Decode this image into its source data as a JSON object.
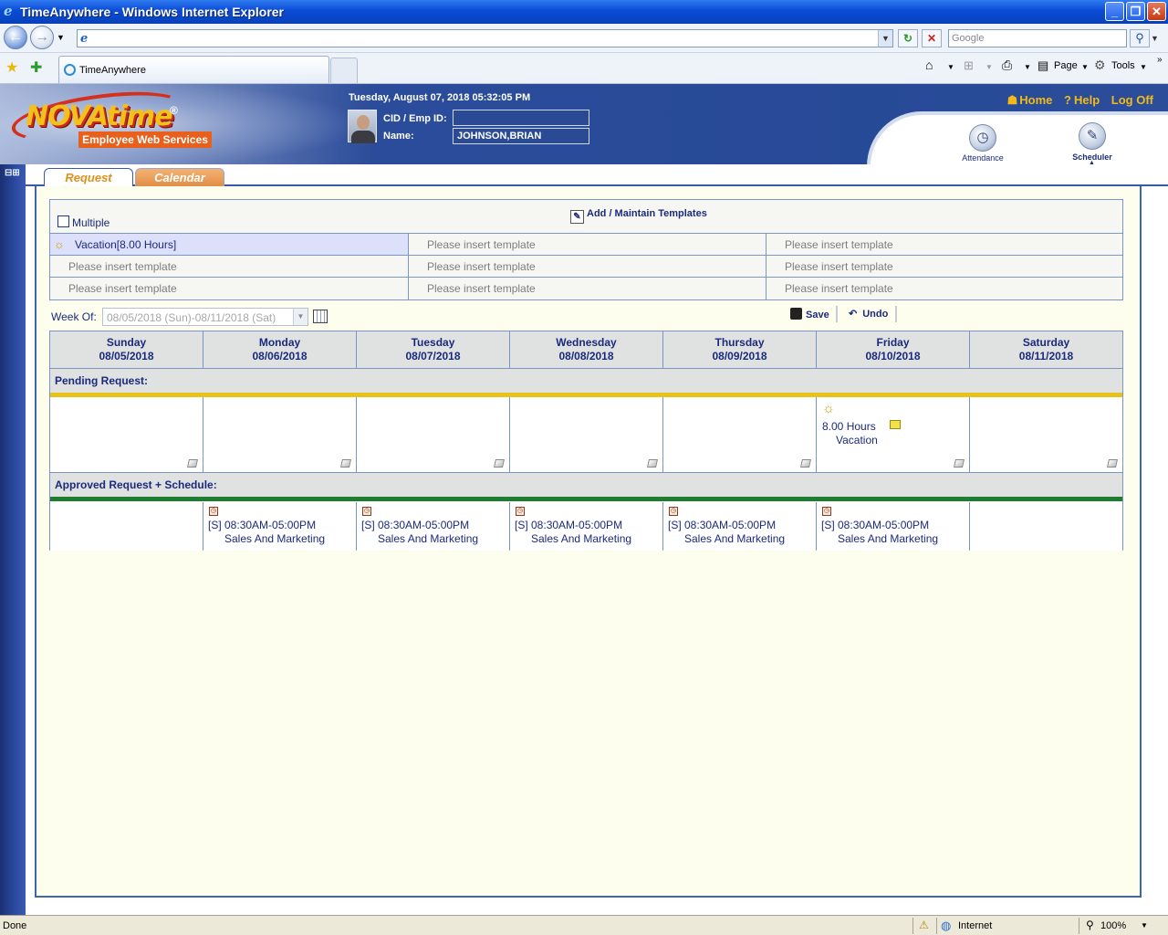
{
  "window": {
    "title": "TimeAnywhere - Windows Internet Explorer",
    "buttons": [
      "_",
      "❐",
      "✕"
    ]
  },
  "address_bar": {
    "url": "",
    "search_placeholder": "Google"
  },
  "browser_tab": {
    "label": "TimeAnywhere"
  },
  "command_bar": {
    "page_label": "Page",
    "tools_label": "Tools"
  },
  "header": {
    "logo_word": "NOVAtime",
    "logo_reg": "®",
    "logo_sub": "Employee Web Services",
    "datetime": "Tuesday, August 07, 2018 05:32:05 PM",
    "cid_label": "CID / Emp ID:",
    "cid_value": "",
    "name_label": "Name:",
    "name_value": "JOHNSON,BRIAN",
    "links": {
      "home": "Home",
      "help": "Help",
      "logoff": "Log Off"
    },
    "nav": [
      {
        "label": "Attendance",
        "icon": "clock-icon"
      },
      {
        "label": "Scheduler",
        "icon": "notepad-icon"
      }
    ]
  },
  "tabs": {
    "request": "Request",
    "calendar": "Calendar"
  },
  "templates": {
    "multiple_label": "Multiple",
    "add_label": "Add / Maintain Templates",
    "cells": [
      [
        "Vacation[8.00 Hours]",
        "Please insert template",
        "Please insert template"
      ],
      [
        "Please insert template",
        "Please insert template",
        "Please insert template"
      ],
      [
        "Please insert template",
        "Please insert template",
        "Please insert template"
      ]
    ]
  },
  "week": {
    "label": "Week Of:",
    "value": "08/05/2018 (Sun)-08/11/2018 (Sat)",
    "save": "Save",
    "undo": "Undo"
  },
  "days": [
    {
      "name": "Sunday",
      "date": "08/05/2018"
    },
    {
      "name": "Monday",
      "date": "08/06/2018"
    },
    {
      "name": "Tuesday",
      "date": "08/07/2018"
    },
    {
      "name": "Wednesday",
      "date": "08/08/2018"
    },
    {
      "name": "Thursday",
      "date": "08/09/2018"
    },
    {
      "name": "Friday",
      "date": "08/10/2018"
    },
    {
      "name": "Saturday",
      "date": "08/11/2018"
    }
  ],
  "pending": {
    "label": "Pending Request:",
    "friday_hours": "8.00 Hours",
    "friday_type": "Vacation"
  },
  "approved": {
    "label": "Approved Request + Schedule:",
    "shift": "[S] 08:30AM-05:00PM",
    "dept": "Sales And Marketing"
  },
  "status": {
    "left": "Done",
    "zone": "Internet",
    "zoom": "100%"
  },
  "colors": {
    "accent_blue": "#1b2a7c",
    "pending_stripe": "#e8c21a",
    "approved_stripe": "#1e7d2e",
    "link_gold": "#f1b91a"
  }
}
